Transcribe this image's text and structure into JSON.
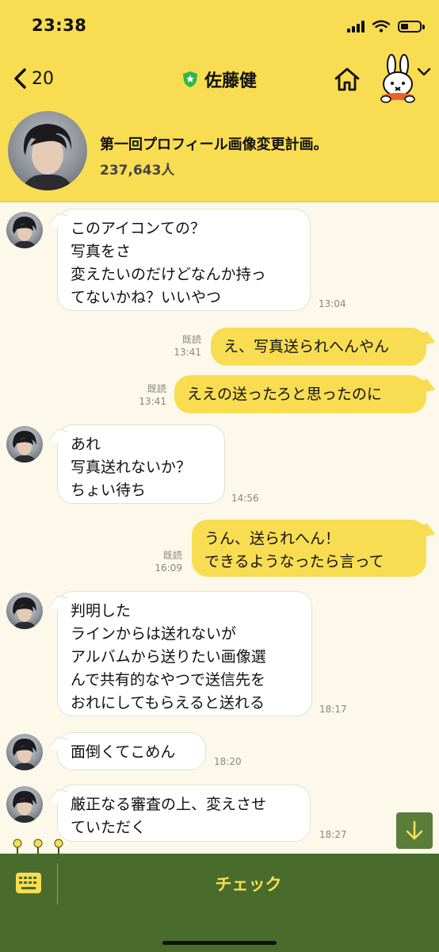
{
  "status_bar": {
    "time": "23:38"
  },
  "nav": {
    "back_count": "20",
    "title": "佐藤健",
    "accent": "#f8dd52"
  },
  "profile": {
    "name": "第一回プロフィール画像変更計画。",
    "count": "237,643人"
  },
  "messages": [
    {
      "side": "in",
      "text": "このアイコンての？\n写真をさ\n変えたいのだけどなんか持っ\nてないかね？いいやつ",
      "time": "13:04"
    },
    {
      "side": "out",
      "text": "え、写真送られへんやん",
      "read": "既読",
      "time": "13:41"
    },
    {
      "side": "out",
      "text": "ええの送ったろと思ったのに",
      "read": "既読",
      "time": "13:41"
    },
    {
      "side": "in",
      "text": "あれ\n写真送れないか？\nちょい待ち",
      "time": "14:56"
    },
    {
      "side": "out",
      "text": "うん、送られへん！\nできるようなったら言って",
      "read": "既読",
      "time": "16:09"
    },
    {
      "side": "in",
      "text": "判明した\nラインからは送れないが\nアルバムから送りたい画像選\nんで共有的なやつで送信先を\nおれにしてもらえると送れる",
      "time": "18:17"
    },
    {
      "side": "in",
      "text": "面倒くてこめん",
      "time": "18:20"
    },
    {
      "side": "in",
      "text": "厳正なる審査の上、変えさせ\nていただく",
      "time": "18:27"
    }
  ],
  "bottom_bar": {
    "check_label": "チェック",
    "bg_color": "#496c2c"
  },
  "icons": {
    "back": "chevron-left-icon",
    "verified": "shield-star-icon",
    "home": "home-icon",
    "mascot": "miffy-icon",
    "menu": "chevron-down-icon",
    "scroll": "arrow-down-icon",
    "keyboard": "keyboard-icon"
  }
}
